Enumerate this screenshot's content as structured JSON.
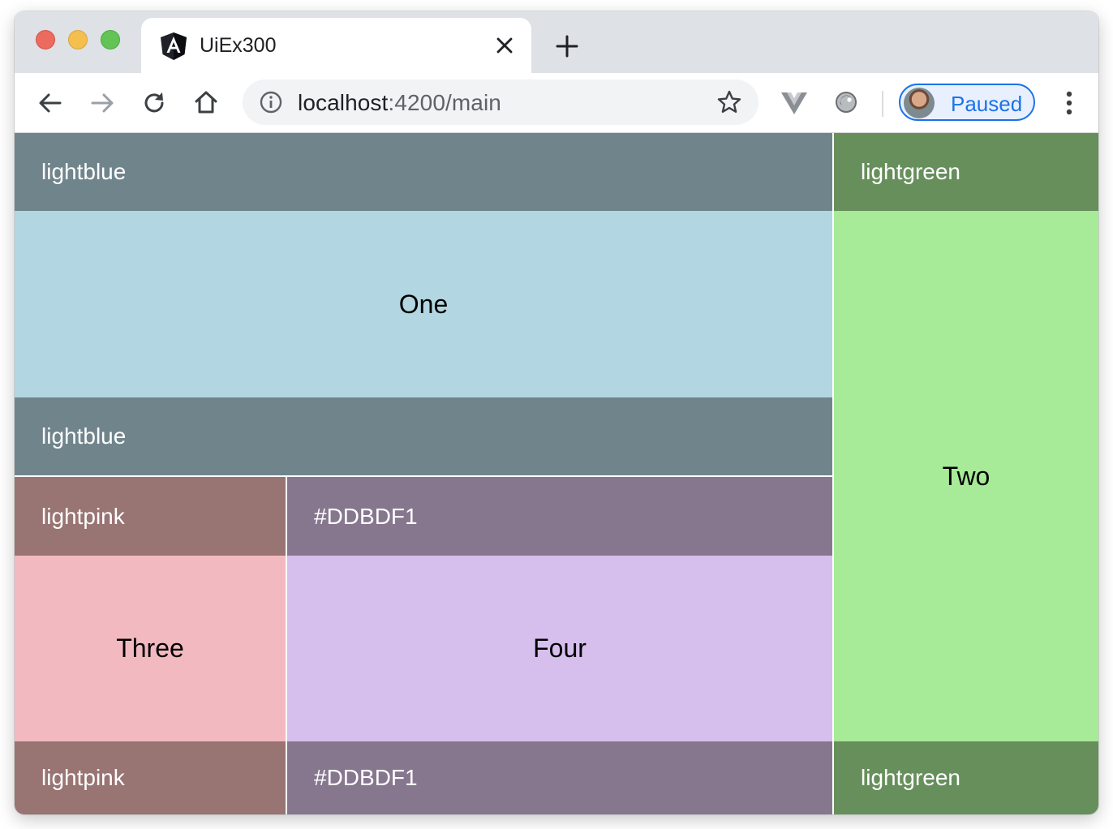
{
  "browser": {
    "tab": {
      "title": "UiEx300",
      "favicon": "angular-logo-icon",
      "close_icon": "close-icon"
    },
    "new_tab_icon": "plus-icon",
    "toolbar": {
      "back_icon": "arrow-left-icon",
      "forward_icon": "arrow-right-icon",
      "reload_icon": "reload-icon",
      "home_icon": "home-icon",
      "info_icon": "info-icon",
      "bookmark_icon": "star-icon",
      "extensions": [
        "vue-devtools-icon",
        "extension-orb-icon"
      ],
      "menu_icon": "kebab-menu-icon"
    },
    "omnibox": {
      "host": "localhost",
      "rest": ":4200/main"
    },
    "profile": {
      "label": "Paused"
    }
  },
  "grid": {
    "tiles": [
      {
        "text": "One",
        "header": "lightblue",
        "footer": "lightblue",
        "color": "#b2d6e2"
      },
      {
        "text": "Two",
        "header": "lightgreen",
        "footer": "lightgreen",
        "color": "#a7ea98"
      },
      {
        "text": "Three",
        "header": "lightpink",
        "footer": "lightpink",
        "color": "#f3b9c1"
      },
      {
        "text": "Four",
        "header": "#DDBDF1",
        "footer": "#DDBDF1",
        "color": "#d6bfed"
      }
    ]
  },
  "colors": {
    "accent": "#1a73e8",
    "tabstrip": "#dee1e6",
    "omnibox": "#f1f3f4"
  }
}
